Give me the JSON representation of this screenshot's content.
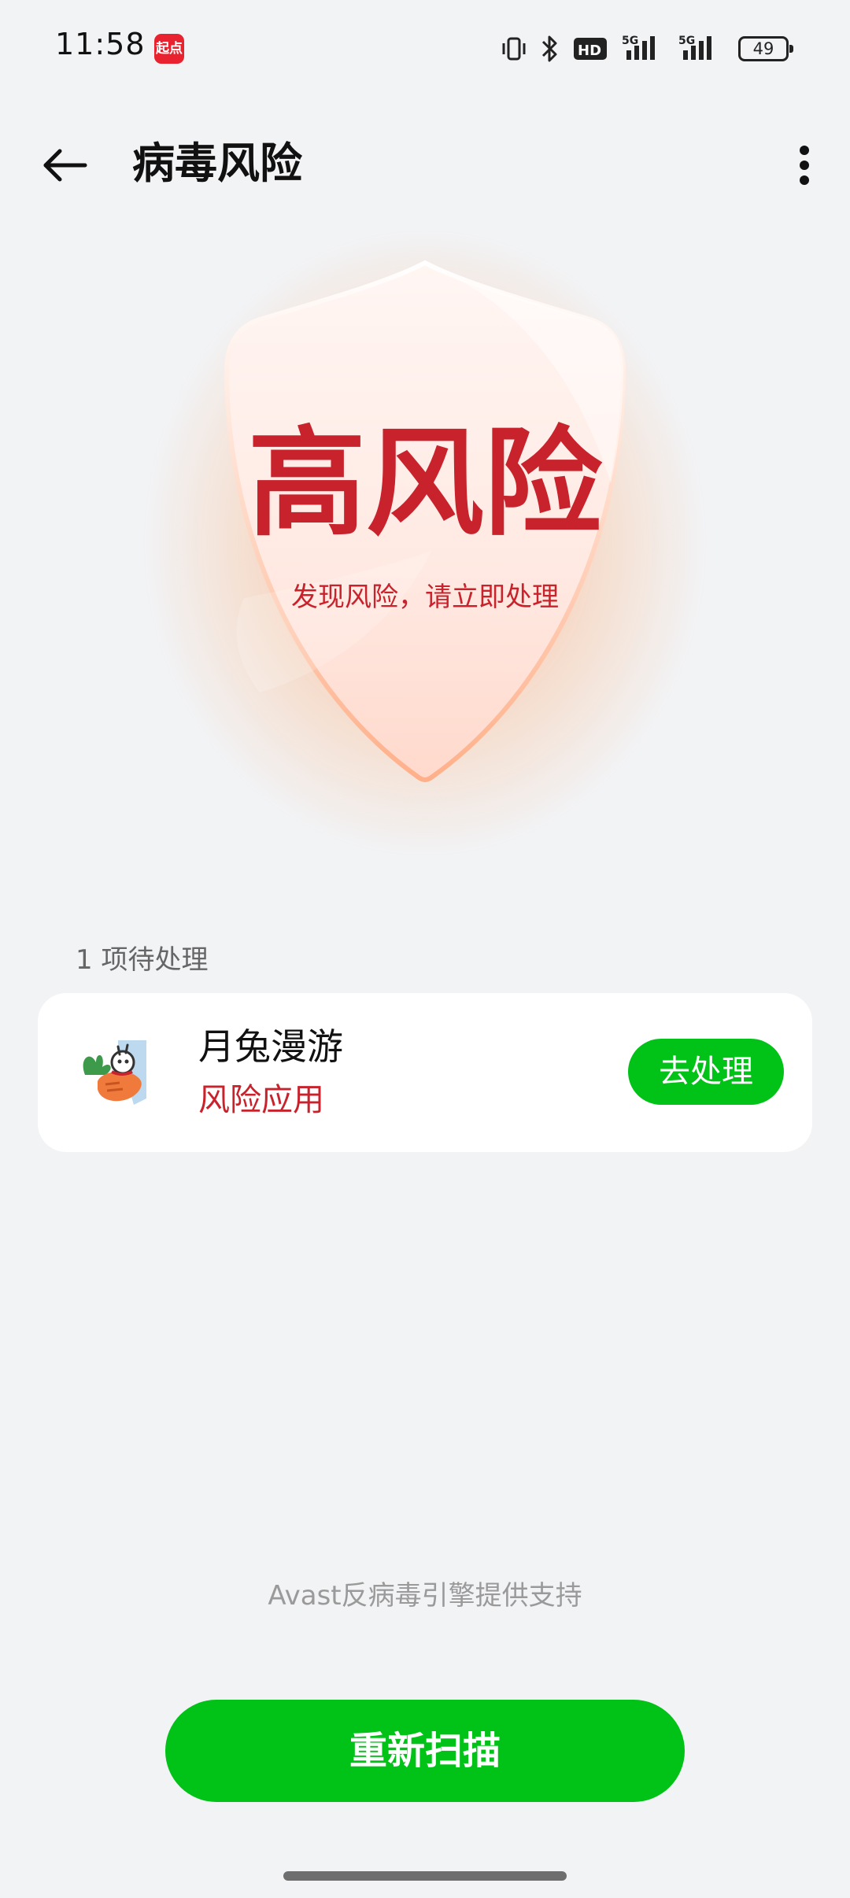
{
  "status_bar": {
    "time": "11:58",
    "notification_app_label": "起点",
    "battery_level": "49",
    "network_labels": [
      "HD",
      "5G",
      "5G"
    ],
    "icons": [
      "vibrate-icon",
      "bluetooth-icon",
      "hd-icon",
      "signal-5g-icon",
      "signal-5g-icon",
      "battery-icon"
    ]
  },
  "app_bar": {
    "title": "病毒风险",
    "back_icon": "arrow-left-icon",
    "more_icon": "more-vertical-icon"
  },
  "shield": {
    "title": "高风险",
    "subtitle": "发现风险，请立即处理",
    "accent_color": "#c8232c"
  },
  "pending": {
    "count_label": "1 项待处理",
    "items": [
      {
        "app_name": "月兔漫游",
        "status": "风险应用",
        "action_label": "去处理",
        "icon": "rabbit-carrot-app-icon"
      }
    ]
  },
  "footer": {
    "powered_by": "Avast反病毒引擎提供支持",
    "rescan_label": "重新扫描",
    "primary_color": "#00c217"
  }
}
